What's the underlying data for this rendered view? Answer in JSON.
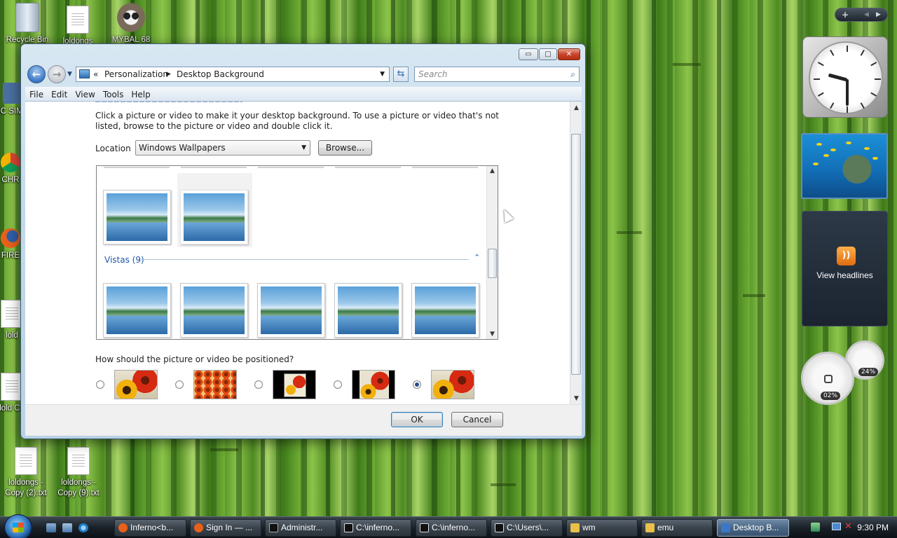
{
  "desktop": {
    "icons": [
      {
        "label": "Recycle Bin",
        "type": "recycle"
      },
      {
        "label": "loldongs",
        "type": "file"
      },
      {
        "label": "MYBAL 68",
        "type": "app"
      },
      {
        "label": "BC SIMU",
        "type": "app"
      },
      {
        "label": "CHR",
        "type": "app"
      },
      {
        "label": "FIRE",
        "type": "app"
      },
      {
        "label": "lold",
        "type": "file"
      },
      {
        "label": "lold Co",
        "type": "file"
      },
      {
        "label": "loldongs - Copy (2).txt",
        "type": "file"
      },
      {
        "label": "loldongs - Copy (9).txt",
        "type": "file"
      }
    ]
  },
  "window": {
    "controls": {
      "minimize": "▭",
      "maximize": "□",
      "close": "✕"
    },
    "breadcrumb": {
      "prefix": "«",
      "items": [
        "Personalization",
        "Desktop Background"
      ]
    },
    "search_placeholder": "Search",
    "menu": [
      "File",
      "Edit",
      "View",
      "Tools",
      "Help"
    ],
    "description": "Click a picture or video to make it your desktop background. To use a picture or video that's not listed, browse to the picture or video and double click it.",
    "location_label": "Location",
    "location_value": "Windows Wallpapers",
    "browse_label": "Browse...",
    "group_label": "Vistas (9)",
    "position_question": "How should the picture or video be positioned?",
    "position_options": [
      "fill",
      "tile",
      "center",
      "fit",
      "stretch"
    ],
    "position_selected": "stretch",
    "ok_label": "OK",
    "cancel_label": "Cancel"
  },
  "gadgets": {
    "feed_label": "View headlines",
    "cpu_meter": "02%",
    "mem_meter": "24%",
    "toolbar_plus": "+"
  },
  "taskbar": {
    "items": [
      {
        "label": "Inferno<b...",
        "icon_color": "#e8611a"
      },
      {
        "label": "Sign In — ...",
        "icon_color": "#e8611a"
      },
      {
        "label": "Administr...",
        "icon_color": "#222222"
      },
      {
        "label": "C:\\inferno...",
        "icon_color": "#111111"
      },
      {
        "label": "C:\\inferno...",
        "icon_color": "#111111"
      },
      {
        "label": "C:\\Users\\...",
        "icon_color": "#111111"
      },
      {
        "label": "wm",
        "icon_color": "#e8c04a"
      },
      {
        "label": "emu",
        "icon_color": "#e8c04a"
      },
      {
        "label": "Desktop B...",
        "icon_color": "#3a78c7"
      }
    ],
    "active_index": 8,
    "time": "9:30 PM"
  }
}
